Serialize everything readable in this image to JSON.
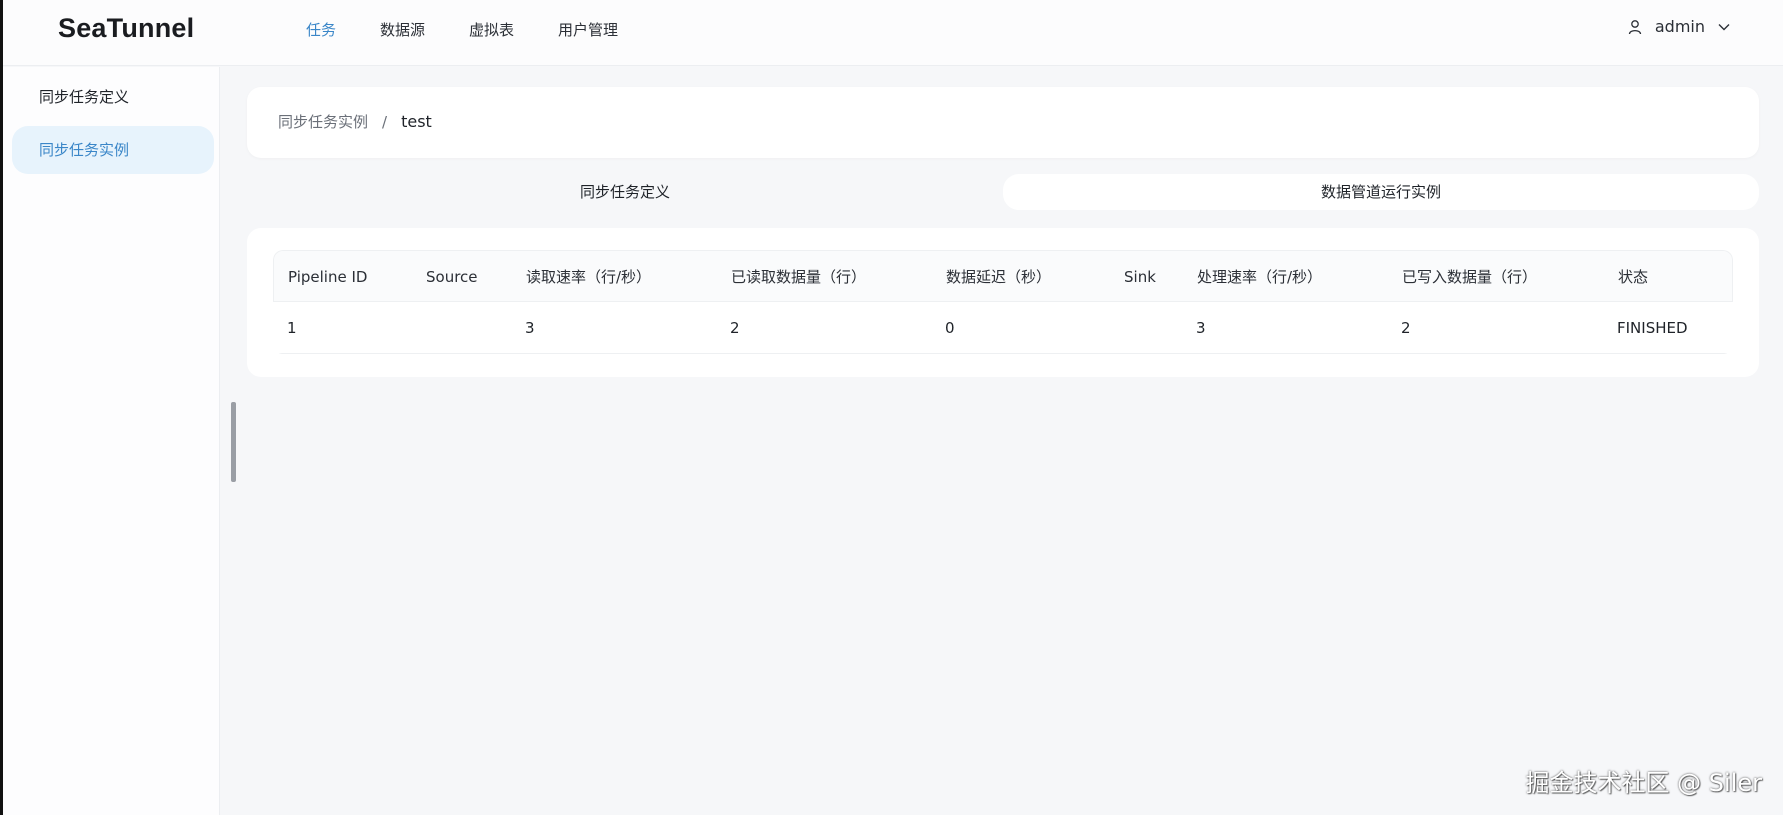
{
  "app": {
    "logo": "SeaTunnel"
  },
  "nav": {
    "items": [
      {
        "label": "任务",
        "active": true
      },
      {
        "label": "数据源",
        "active": false
      },
      {
        "label": "虚拟表",
        "active": false
      },
      {
        "label": "用户管理",
        "active": false
      }
    ]
  },
  "user": {
    "name": "admin",
    "icon": "user-icon",
    "chevron": "chevron-down-icon"
  },
  "sidebar": {
    "items": [
      {
        "label": "同步任务定义",
        "active": false
      },
      {
        "label": "同步任务实例",
        "active": true
      }
    ]
  },
  "breadcrumb": {
    "parent": "同步任务实例",
    "separator": "/",
    "current": "test"
  },
  "tabs": [
    {
      "label": "同步任务定义",
      "active": false
    },
    {
      "label": "数据管道运行实例",
      "active": true
    }
  ],
  "table": {
    "columns": [
      "Pipeline ID",
      "Source",
      "读取速率（行/秒）",
      "已读取数据量（行）",
      "数据延迟（秒）",
      "Sink",
      "处理速率（行/秒）",
      "已写入数据量（行）",
      "状态"
    ],
    "rows": [
      [
        "1",
        "",
        "3",
        "2",
        "0",
        "",
        "3",
        "2",
        "FINISHED"
      ]
    ]
  },
  "watermark": "掘金技术社区 @ Siler",
  "colors": {
    "accent": "#3a86c8",
    "active_bg": "#e7f3fc",
    "page_bg": "#f6f7f9"
  }
}
